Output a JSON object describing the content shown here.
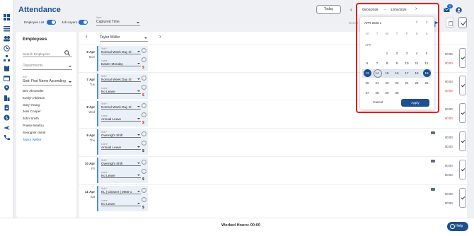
{
  "header": {
    "title": "Attendance",
    "toggles": [
      {
        "label": "Employee List"
      },
      {
        "label": "Job Layers"
      }
    ],
    "view": {
      "label": "View",
      "value": "Captured Time"
    },
    "today_label": "Today",
    "date_from": "06/04/2026",
    "date_to": "12/04/2026",
    "description_placeholder": "Descri",
    "notification_count": "9"
  },
  "employees": {
    "title": "Employees",
    "search_placeholder": "Search Employees",
    "departments_label": "Departments",
    "sort_label": "Sort",
    "sort_value": "Sort: First Name Ascending",
    "list": [
      "Ben Alexander",
      "Evelyn Ableson",
      "Gary Young",
      "Jess Cooper",
      "John Smith",
      "Praise Meafou",
      "Seungmin Seok",
      "Taylor Weller"
    ],
    "selected": "Taylor Weller"
  },
  "schedule": {
    "employee_select": "Taylor Weller",
    "shift_label": "Shift *",
    "leave_label": "Leave",
    "days": [
      {
        "date": "6 Apr",
        "dow": "Mon",
        "shift": "Normal Week Day Sl",
        "leave": "Easter Monday",
        "t1": "00:00",
        "t2": "00:00",
        "t2_red": true
      },
      {
        "date": "7 Apr",
        "dow": "Tue",
        "shift": "Normal Week Day Sl",
        "leave": "No Leave",
        "t1": "00:00",
        "t2": "00:00",
        "t2_red": true
      },
      {
        "date": "8 Apr",
        "dow": "Wed",
        "shift": "Normal Week Day Sl",
        "leave": "Annual Leave",
        "t1": "00:00",
        "t2": "00:00",
        "t2_red": true
      },
      {
        "date": "9 Apr",
        "dow": "Thu",
        "shift": "Overnight Shift",
        "leave": "Annual Leave",
        "t1": "00:00",
        "t2": "00:00",
        "t2_red": false
      },
      {
        "date": "10 Apr",
        "dow": "Fri",
        "shift": "Overnight Shift",
        "leave": "No Leave",
        "t1": "00:00",
        "t2": "00:00",
        "t2_red": false
      },
      {
        "date": "11 Apr",
        "dow": "Sat",
        "shift": "KL | Cleaner | 0900-1",
        "leave": "No Leave",
        "t1": "00:00",
        "t2": "00:00",
        "t2_red": false
      }
    ]
  },
  "footer": {
    "worked_hours": "Worked Hours: 00:00",
    "help": "Help"
  },
  "calendar": {
    "month_header": "APR 2026",
    "month_label": "APR",
    "weekdays": [
      "M",
      "T",
      "W",
      "T",
      "F",
      "S",
      "S"
    ],
    "cancel": "Cancel",
    "apply": "Apply",
    "weeks": [
      [
        "",
        "",
        "1",
        "2",
        "3",
        "4",
        "5"
      ],
      [
        "6",
        "7",
        "8",
        "9",
        "10",
        "11",
        "12"
      ],
      [
        "13",
        "14",
        "15",
        "16",
        "17",
        "18",
        "19"
      ],
      [
        "20",
        "21",
        "22",
        "23",
        "24",
        "25",
        "26"
      ],
      [
        "27",
        "28",
        "29",
        "30",
        "",
        "",
        ""
      ]
    ],
    "range_start": "13",
    "range_end": "19",
    "today": "14"
  },
  "colors": {
    "brand": "#1e4f8f",
    "accent": "#1e6fd0",
    "alert": "#d9302c",
    "highlight": "#e02020"
  }
}
